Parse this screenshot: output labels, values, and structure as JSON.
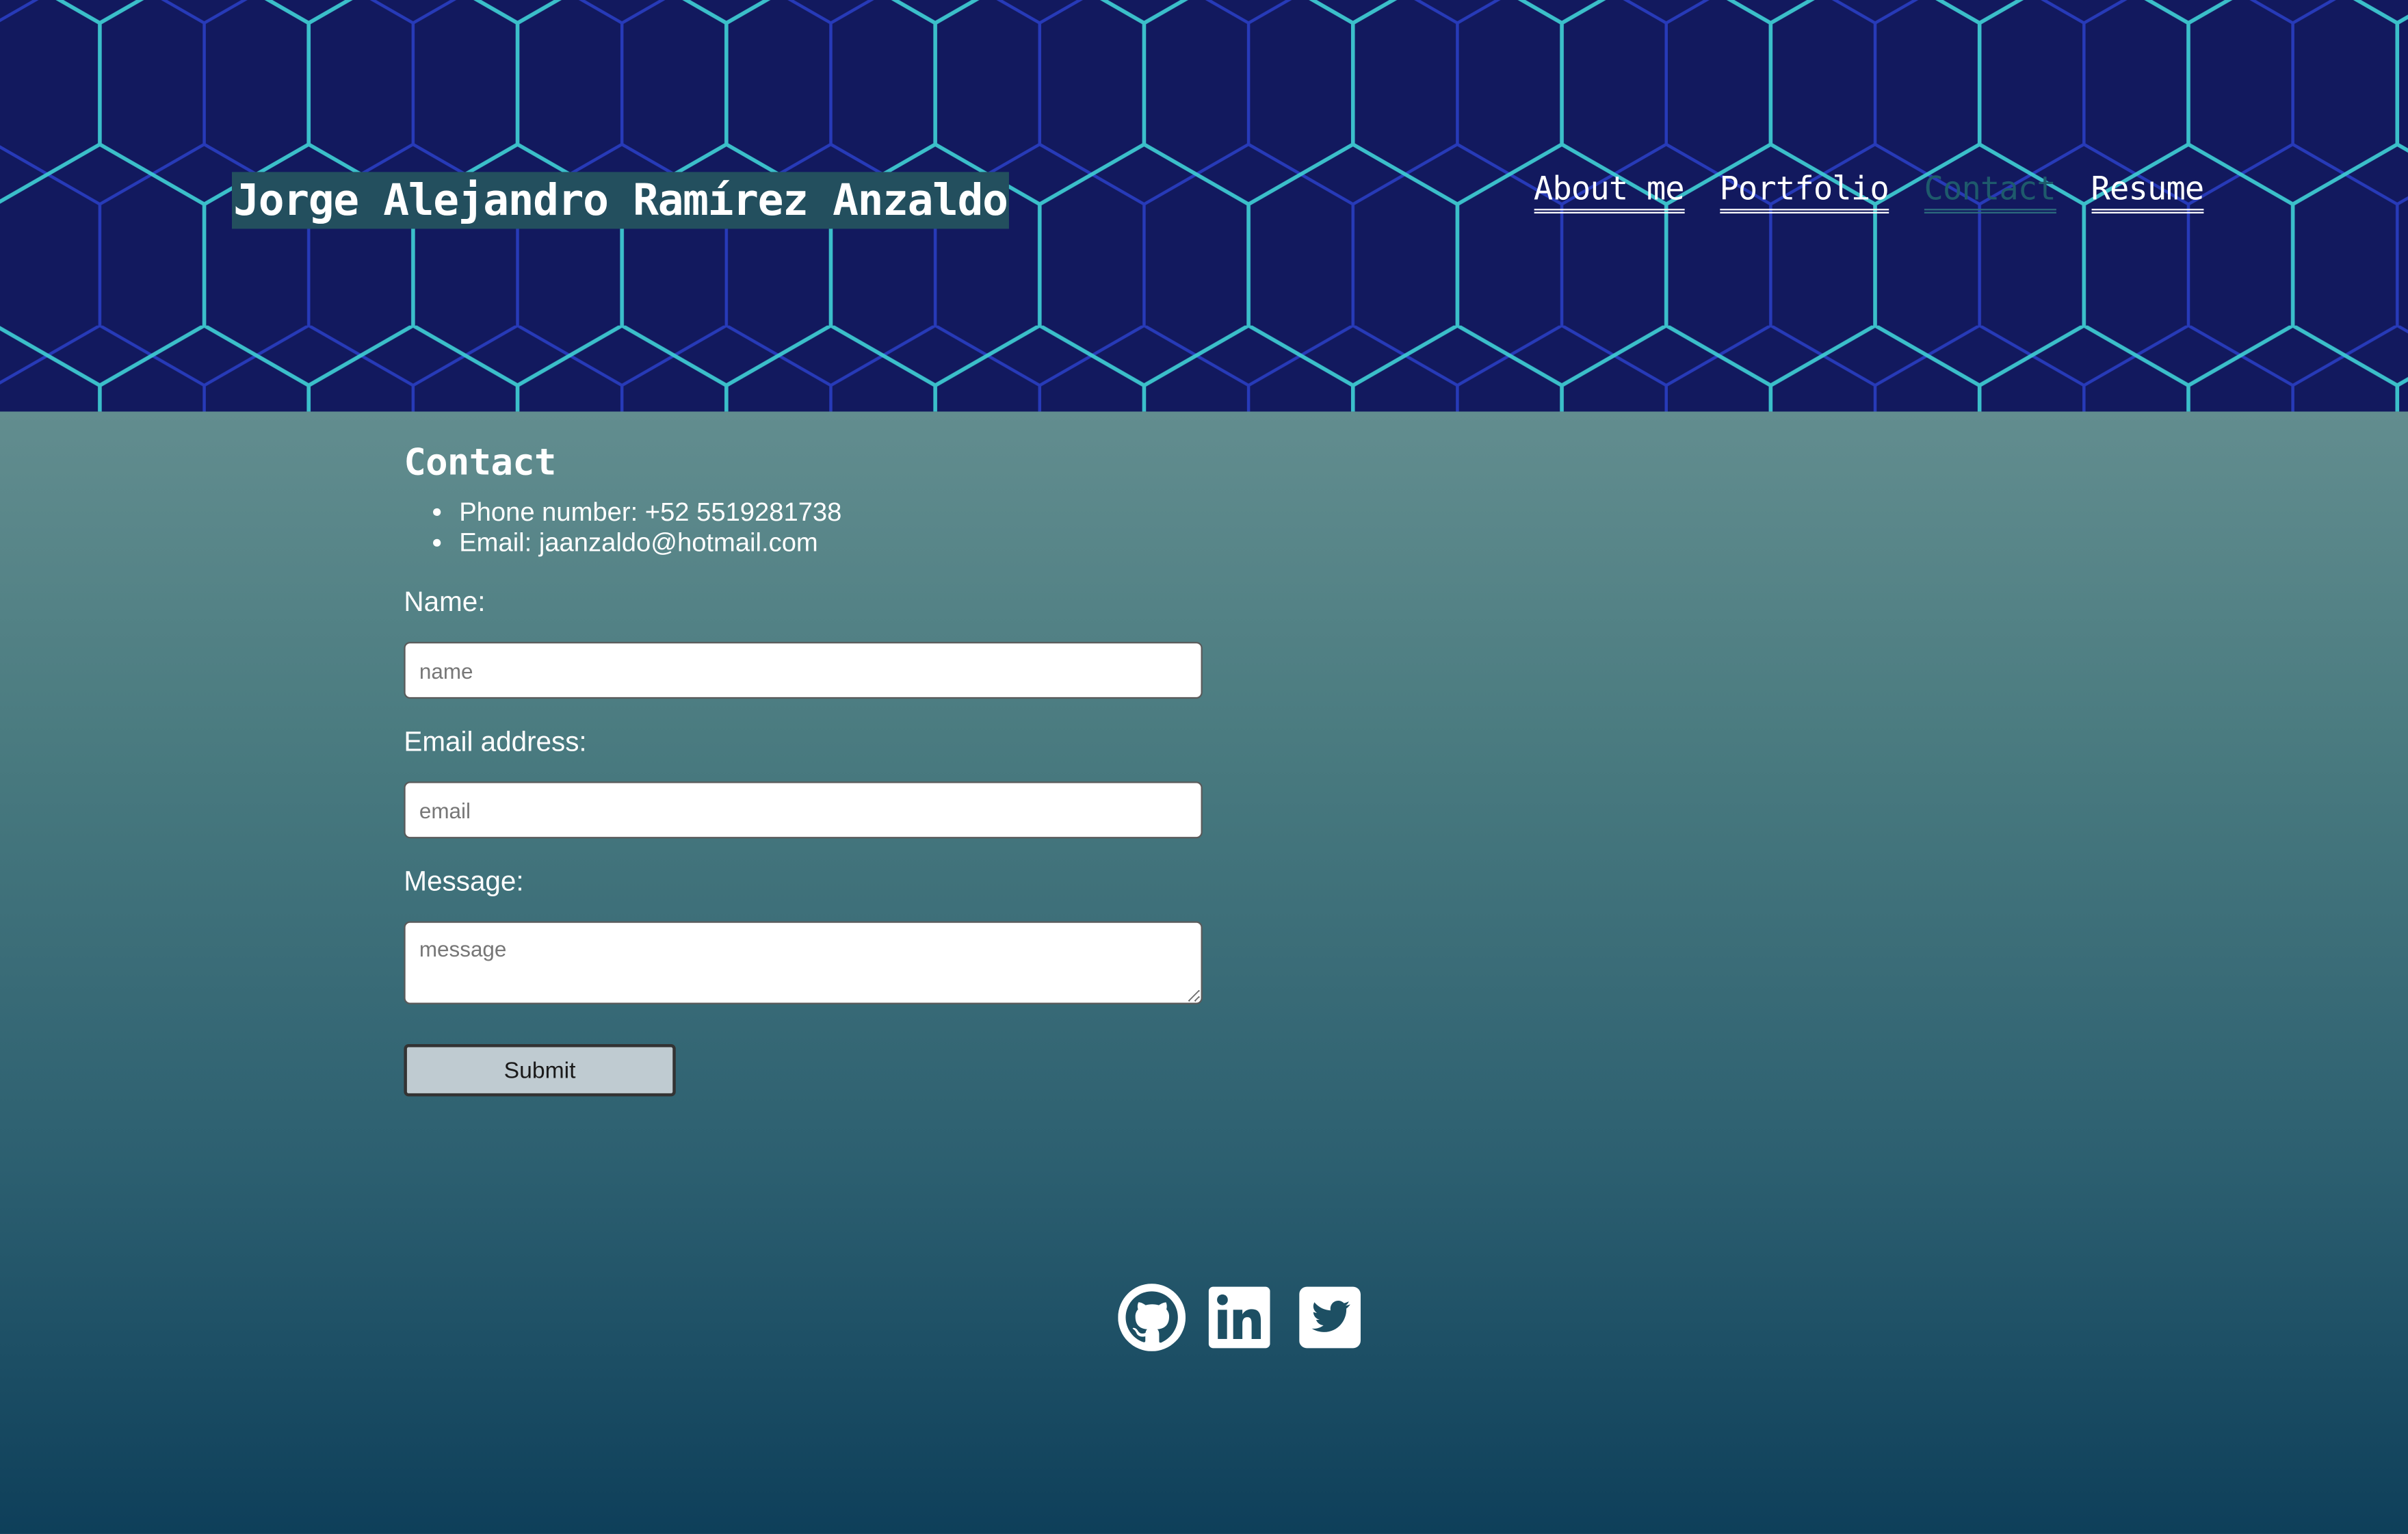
{
  "header": {
    "site_title": "Jorge Alejandro Ramírez Anzaldo",
    "nav": [
      {
        "label": "About me",
        "active": false
      },
      {
        "label": "Portfolio",
        "active": false
      },
      {
        "label": "Contact",
        "active": true
      },
      {
        "label": "Resume",
        "active": false
      }
    ]
  },
  "contact": {
    "heading": "Contact",
    "details": [
      "Phone number: +52 5519281738",
      "Email: jaanzaldo@hotmail.com"
    ],
    "form": {
      "name_label": "Name:",
      "name_placeholder": "name",
      "name_value": "",
      "email_label": "Email address:",
      "email_placeholder": "email",
      "email_value": "",
      "message_label": "Message:",
      "message_placeholder": "message",
      "message_value": "",
      "submit_label": "Submit"
    }
  },
  "footer": {
    "social_icons": [
      "github-icon",
      "linkedin-icon",
      "twitter-icon"
    ]
  },
  "colors": {
    "header_bg": "#12195e",
    "hex_line_bright": "#3fd2d6",
    "hex_line_dim": "#2a40c8",
    "title_bg": "#234f5e",
    "active_link": "#1e5a6c",
    "button_bg": "#bfcbd1"
  }
}
